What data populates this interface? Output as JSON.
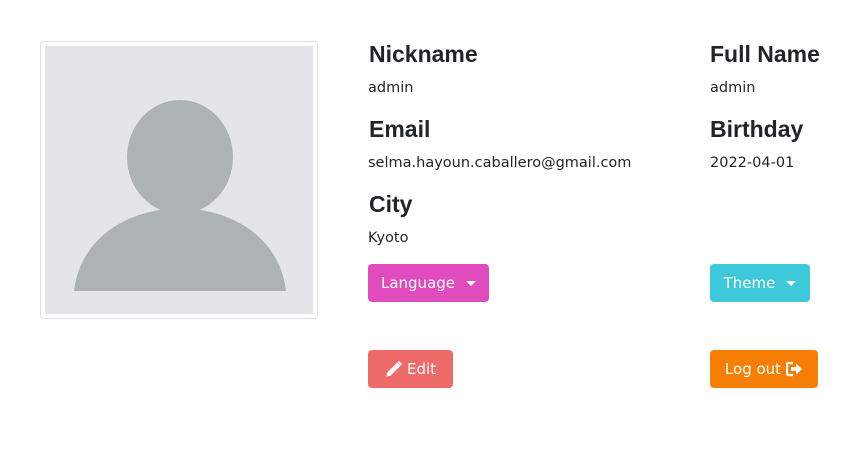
{
  "profile": {
    "avatar_icon": "user-placeholder-icon",
    "fields": {
      "nickname": {
        "label": "Nickname",
        "value": "admin"
      },
      "full_name": {
        "label": "Full Name",
        "value": "admin"
      },
      "email": {
        "label": "Email",
        "value": "selma.hayoun.caballero@gmail.com"
      },
      "birthday": {
        "label": "Birthday",
        "value": "2022-04-01"
      },
      "city": {
        "label": "City",
        "value": "Kyoto"
      }
    }
  },
  "buttons": {
    "language": {
      "label": "Language",
      "color": "#e04bbd",
      "icon": "caret-down-icon"
    },
    "theme": {
      "label": "Theme",
      "color": "#3ec9db",
      "icon": "caret-down-icon"
    },
    "edit": {
      "label": "Edit",
      "color": "#ef6b6a",
      "icon": "pencil-icon"
    },
    "logout": {
      "label": "Log out",
      "color": "#f77e05",
      "icon": "sign-out-icon"
    }
  }
}
